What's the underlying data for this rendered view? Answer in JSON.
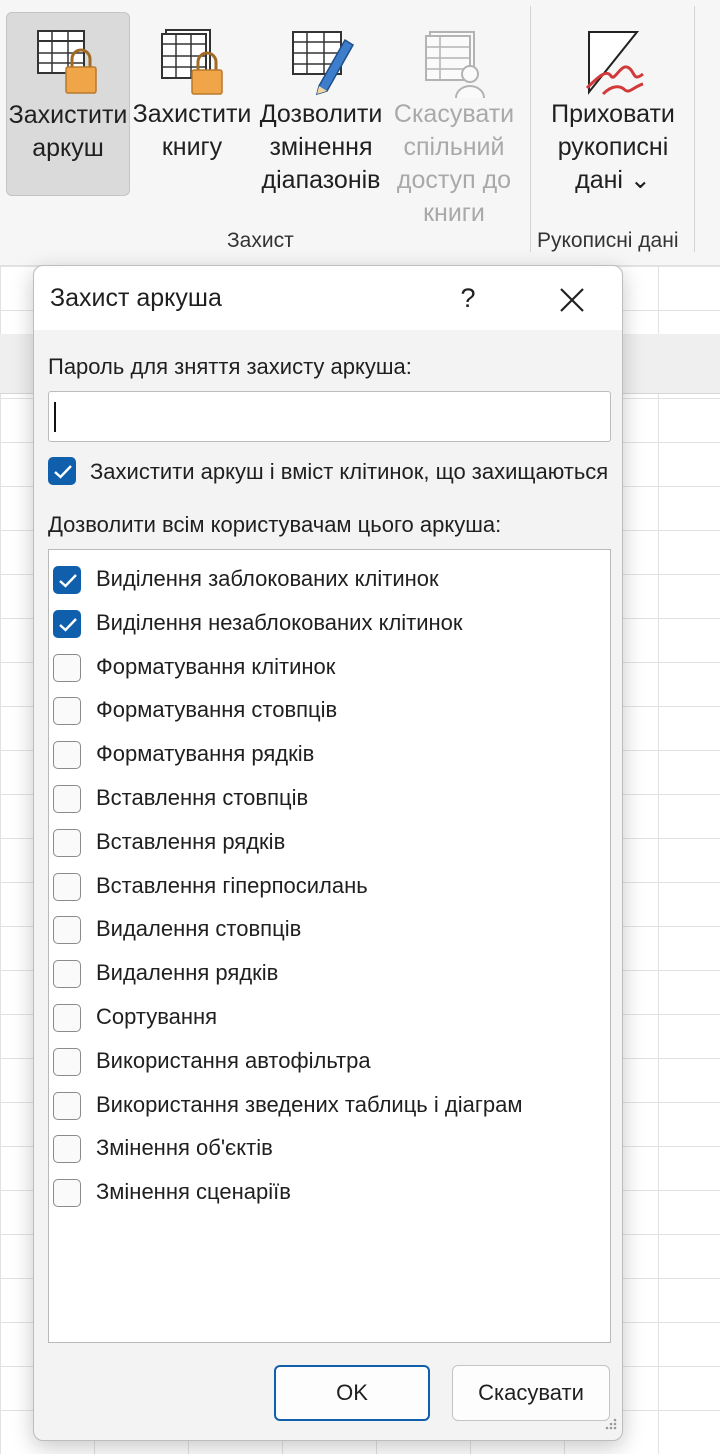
{
  "ribbon": {
    "buttons": [
      {
        "label": "Захистити\nаркуш",
        "icon": "protect-sheet-icon",
        "state": "active"
      },
      {
        "label": "Захистити\nкнигу",
        "icon": "protect-workbook-icon",
        "state": "normal"
      },
      {
        "label": "Дозволити\nзмінення\nдіапазонів",
        "icon": "allow-edit-ranges-icon",
        "state": "normal"
      },
      {
        "label": "Скасувати\nспільний\nдоступ до\nкниги",
        "icon": "unshare-workbook-icon",
        "state": "disabled"
      },
      {
        "label": "Приховати\nрукописні\nдані ⌄",
        "icon": "hide-ink-icon",
        "state": "normal"
      }
    ],
    "groups": {
      "protect": "Захист",
      "ink": "Рукописні дані"
    }
  },
  "dialog": {
    "title": "Захист аркуша",
    "help": "?",
    "password_label": "Пароль для зняття захисту аркуша:",
    "password_value": "",
    "protect_checkbox": {
      "label": "Захистити аркуш і вміст клітинок, що захищаються",
      "checked": true
    },
    "allow_label": "Дозволити всім користувачам цього аркуша:",
    "options": [
      {
        "label": "Виділення заблокованих клітинок",
        "checked": true
      },
      {
        "label": "Виділення незаблокованих клітинок",
        "checked": true
      },
      {
        "label": "Форматування клітинок",
        "checked": false
      },
      {
        "label": "Форматування стовпців",
        "checked": false
      },
      {
        "label": "Форматування рядків",
        "checked": false
      },
      {
        "label": "Вставлення стовпців",
        "checked": false
      },
      {
        "label": "Вставлення рядків",
        "checked": false
      },
      {
        "label": "Вставлення гіперпосилань",
        "checked": false
      },
      {
        "label": "Видалення стовпців",
        "checked": false
      },
      {
        "label": "Видалення рядків",
        "checked": false
      },
      {
        "label": "Сортування",
        "checked": false
      },
      {
        "label": "Використання автофільтра",
        "checked": false
      },
      {
        "label": "Використання зведених таблиць і діаграм",
        "checked": false
      },
      {
        "label": "Змінення об'єктів",
        "checked": false
      },
      {
        "label": "Змінення сценаріїв",
        "checked": false
      }
    ],
    "ok_label": "OK",
    "cancel_label": "Скасувати"
  },
  "colors": {
    "accent": "#0f5fad",
    "lock": "#f0a648",
    "ink_red": "#d23a3a",
    "pencil_blue": "#3d7dcc"
  }
}
